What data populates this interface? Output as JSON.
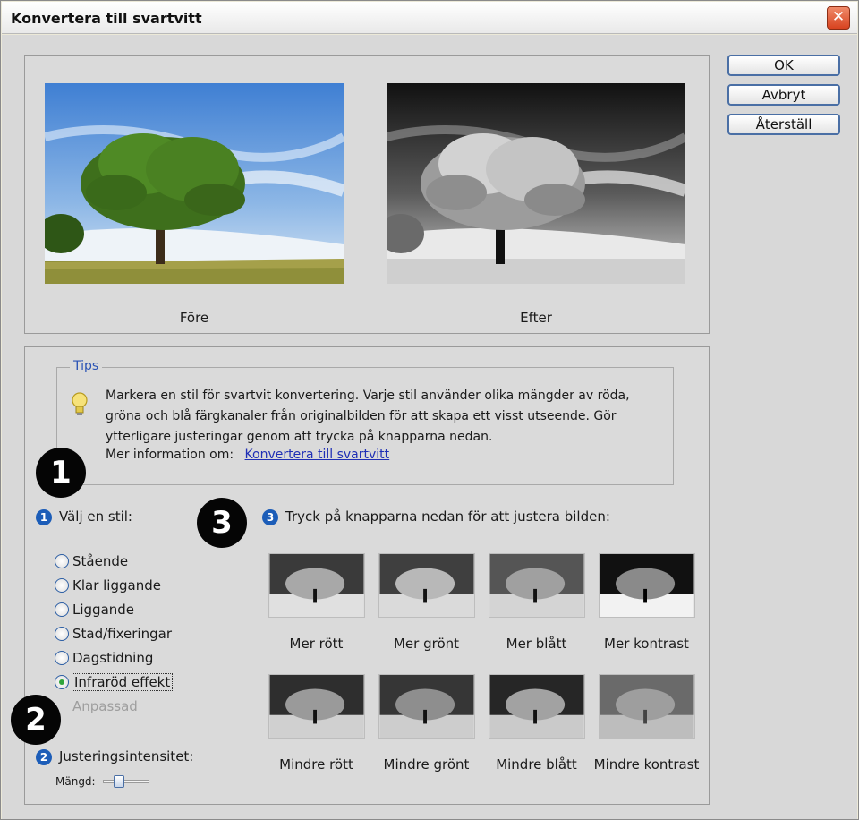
{
  "window": {
    "title": "Konvertera till svartvitt",
    "close_glyph": "✕"
  },
  "preview": {
    "before_label": "Före",
    "after_label": "Efter"
  },
  "buttons": {
    "ok": "OK",
    "cancel": "Avbryt",
    "reset": "Återställ"
  },
  "tips": {
    "legend": "Tips",
    "text": "Markera en stil för svartvit konvertering. Varje stil använder olika mängder av röda, gröna och blå färgkanaler från originalbilden för att skapa ett visst utseende. Gör ytterligare justeringar genom att trycka på knapparna nedan.",
    "more_info": "Mer information om:",
    "link": "Konvertera till svartvitt",
    "icon": "lightbulb-icon"
  },
  "badges": {
    "one": "1",
    "two": "2",
    "three": "3"
  },
  "style_section": {
    "step": "1",
    "label": "Välj en stil:",
    "options": [
      {
        "label": "Stående",
        "checked": false
      },
      {
        "label": "Klar liggande",
        "checked": false
      },
      {
        "label": "Liggande",
        "checked": false
      },
      {
        "label": "Stad/fixeringar",
        "checked": false
      },
      {
        "label": "Dagstidning",
        "checked": false
      },
      {
        "label": "Infraröd effekt",
        "checked": true
      }
    ],
    "disabled_option": "Anpassad"
  },
  "adjust_section": {
    "step": "3",
    "label": "Tryck på knapparna nedan för att justera bilden:",
    "buttons": [
      {
        "label": "Mer rött"
      },
      {
        "label": "Mer grönt"
      },
      {
        "label": "Mer blått"
      },
      {
        "label": "Mer kontrast"
      },
      {
        "label": "Mindre rött"
      },
      {
        "label": "Mindre grönt"
      },
      {
        "label": "Mindre blått"
      },
      {
        "label": "Mindre kontrast"
      }
    ]
  },
  "intensity_section": {
    "step": "2",
    "label": "Justeringsintensitet:",
    "amount_label": "Mängd:",
    "amount_value": 0.3
  },
  "colors": {
    "accent": "#1c5db8",
    "link": "#1f2fb5",
    "tips_legend": "#2a53b5",
    "close": "#d8421f"
  }
}
